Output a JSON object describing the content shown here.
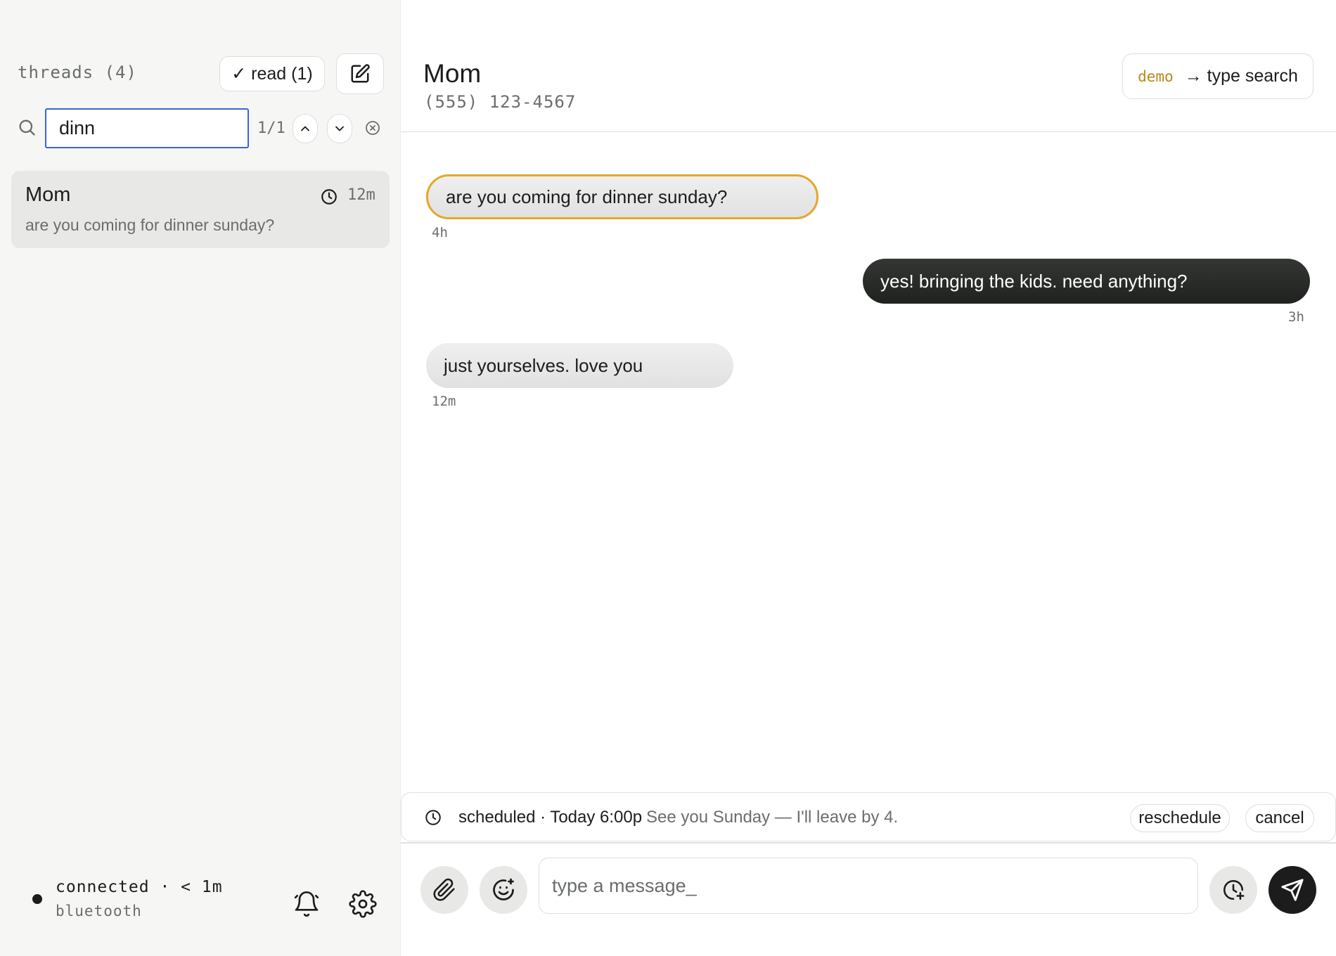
{
  "sidebar": {
    "title": "threads (4)",
    "read_button": "✓ read (1)",
    "compose_icon": "compose-icon",
    "search": {
      "value": "dinn",
      "match_count": "1/1"
    },
    "threads": [
      {
        "name": "Mom",
        "time": "12m",
        "preview": "are you coming for dinner sunday?",
        "icon": "clock-icon"
      }
    ],
    "status": {
      "line1": "connected · < 1m",
      "line2": "bluetooth"
    }
  },
  "conversation": {
    "contact_name": "Mom",
    "contact_phone": "(555) 123-4567",
    "demo_tag": "demo",
    "demo_label": "→ type search",
    "messages": [
      {
        "direction": "in",
        "text": "are you coming for dinner sunday?",
        "time": "4h",
        "highlighted": true
      },
      {
        "direction": "out",
        "text": "yes! bringing the kids. need anything?",
        "time": "3h",
        "highlighted": false
      },
      {
        "direction": "in",
        "text": "just yourselves. love you",
        "time": "12m",
        "highlighted": false
      }
    ],
    "scheduled": {
      "label": "scheduled · Today 6:00p",
      "preview": "See you Sunday — I'll leave by 4.",
      "reschedule": "reschedule",
      "cancel": "cancel"
    },
    "composer": {
      "placeholder": "type a message_"
    }
  },
  "colors": {
    "accent_blue": "#3b63d9",
    "highlight": "#e3a82a",
    "demo_tag": "#b8891a",
    "outgoing_bubble": "#2a2c2a"
  }
}
